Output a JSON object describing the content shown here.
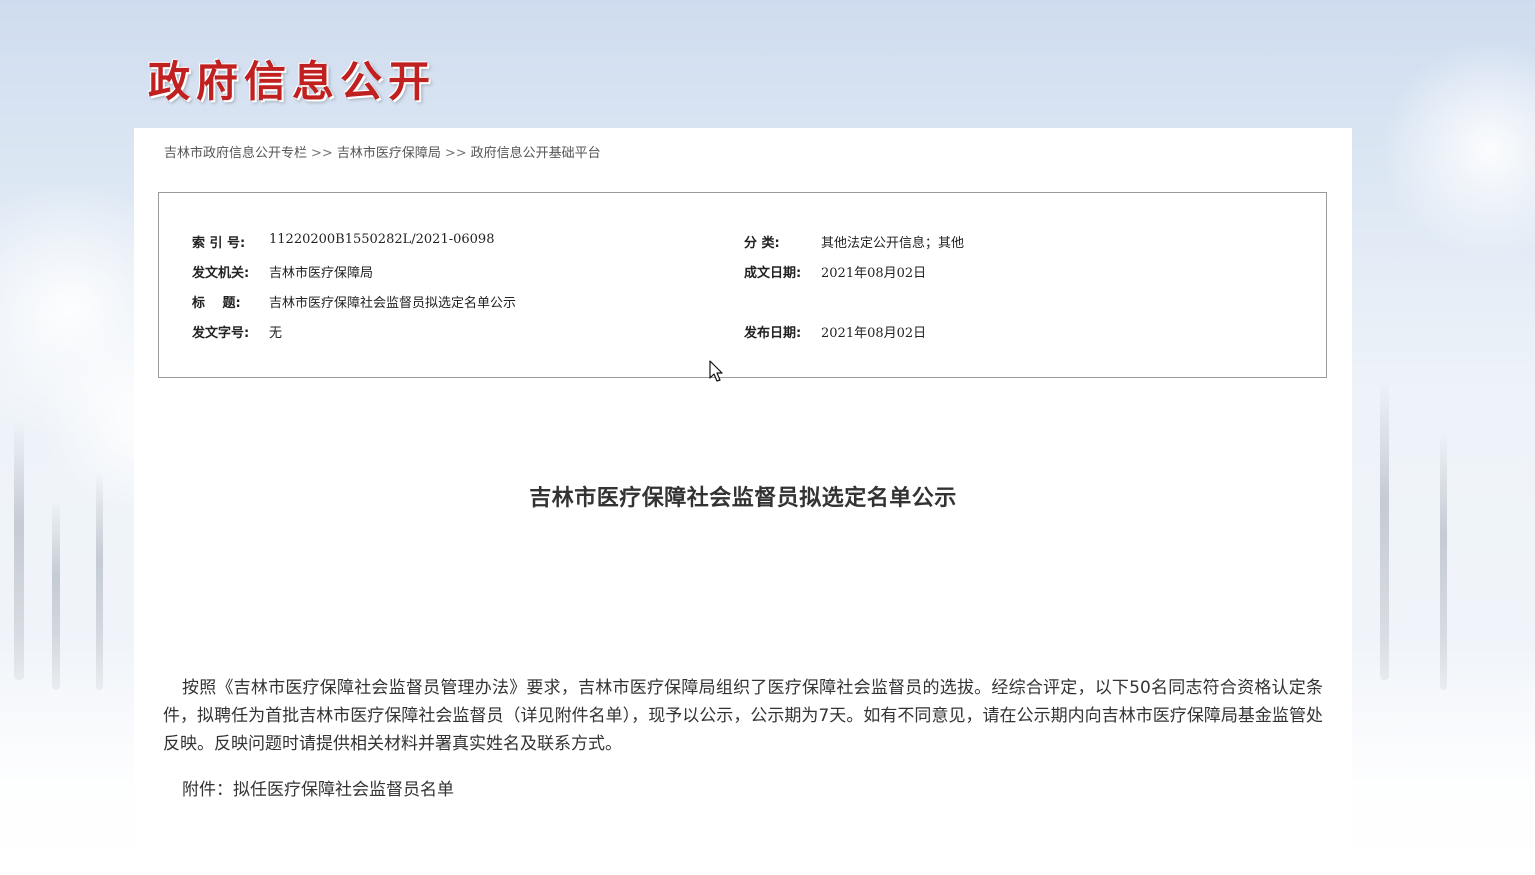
{
  "header": {
    "logo_text": "政府信息公开"
  },
  "breadcrumb": {
    "items": [
      "吉林市政府信息公开专栏",
      "吉林市医疗保障局",
      "政府信息公开基础平台"
    ],
    "separator": ">>"
  },
  "meta": {
    "index_label": "索 引 号:",
    "index_value": "11220200B1550282L/2021-06098",
    "category_label": "分 类:",
    "category_value": "其他法定公开信息；其他",
    "issuer_label": "发文机关:",
    "issuer_value": "吉林市医疗保障局",
    "written_date_label": "成文日期:",
    "written_date_value": "2021年08月02日",
    "title_label": "标　 题:",
    "title_value": "吉林市医疗保障社会监督员拟选定名单公示",
    "doc_number_label": "发文字号:",
    "doc_number_value": "无",
    "publish_date_label": "发布日期:",
    "publish_date_value": "2021年08月02日"
  },
  "article": {
    "title": "吉林市医疗保障社会监督员拟选定名单公示",
    "body": "按照《吉林市医疗保障社会监督员管理办法》要求，吉林市医疗保障局组织了医疗保障社会监督员的选拔。经综合评定，以下50名同志符合资格认定条件，拟聘任为首批吉林市医疗保障社会监督员（详见附件名单），现予以公示，公示期为7天。如有不同意见，请在公示期内向吉林市医疗保障局基金监管处反映。反映问题时请提供相关材料并署真实姓名及联系方式。",
    "attachment": "附件：拟任医疗保障社会监督员名单"
  },
  "colors": {
    "logo": "#c0201f",
    "border": "#9a9a9a",
    "text": "#333333"
  }
}
